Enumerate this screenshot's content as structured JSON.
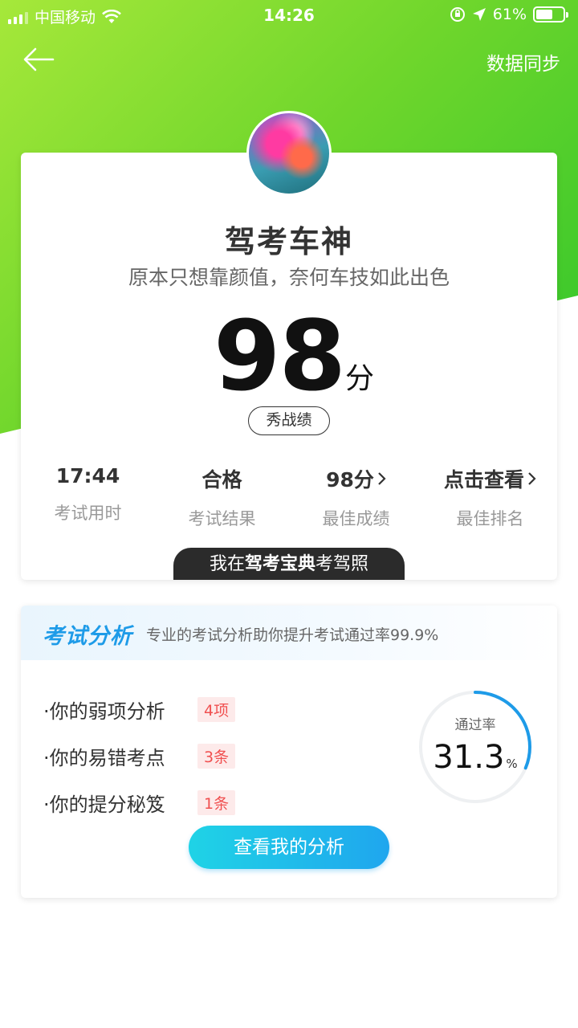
{
  "status_bar": {
    "carrier": "中国移动",
    "time": "14:26",
    "battery_percent": "61%",
    "battery_level": 0.61,
    "icons": [
      "signal-icon",
      "wifi-icon",
      "orientation-lock-icon",
      "location-icon",
      "battery-icon"
    ]
  },
  "nav": {
    "back_icon": "arrow-left-icon",
    "sync_label": "数据同步"
  },
  "result": {
    "title": "驾考车神",
    "subtitle": "原本只想靠颜值，奈何车技如此出色",
    "score": "98",
    "score_unit": "分",
    "share_label": "秀战绩",
    "stats": [
      {
        "value": "17:44",
        "label": "考试用时"
      },
      {
        "value": "合格",
        "label": "考试结果"
      },
      {
        "value": "98分",
        "label": "最佳成绩"
      },
      {
        "value": "点击查看",
        "label": "最佳排名"
      }
    ],
    "banner": {
      "prefix": "我在",
      "brand": "驾考宝典",
      "suffix": "考驾照"
    }
  },
  "analysis": {
    "title": "考试分析",
    "subtitle": "专业的考试分析助你提升考试通过率99.9%",
    "items": [
      {
        "label": "·你的弱项分析",
        "badge": "4项"
      },
      {
        "label": "·你的易错考点",
        "badge": "3条"
      },
      {
        "label": "·你的提分秘笈",
        "badge": "1条"
      }
    ],
    "pass_rate_label": "通过率",
    "pass_rate_value": "31.3",
    "pass_rate_unit": "%",
    "pass_rate": 31.3,
    "cta_label": "查看我的分析"
  },
  "colors": {
    "hero_gradient_start": "#a6e83a",
    "hero_gradient_end": "#2ec52c",
    "accent_blue": "#1e9be8",
    "badge_red": "#f05050"
  }
}
